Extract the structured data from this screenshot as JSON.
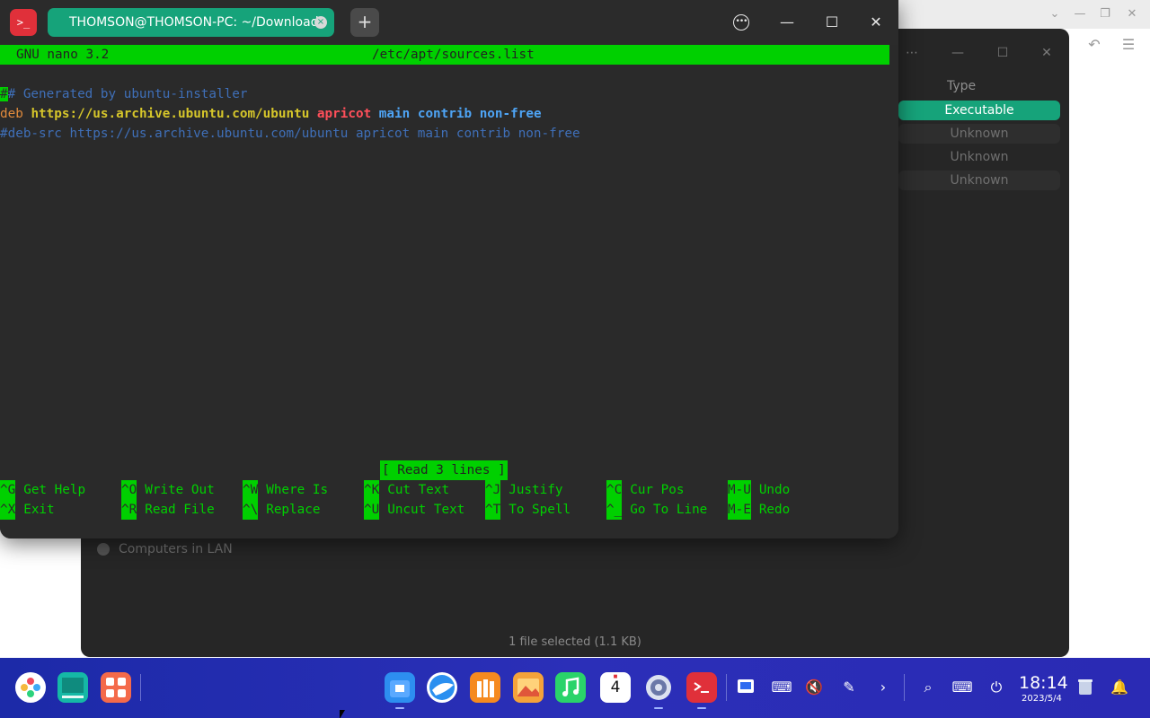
{
  "terminal": {
    "tab_title": "THOMSON@THOMSON-PC: ~/Downloads",
    "tab_close": "×",
    "new_tab": "+",
    "app_icon": ">_",
    "menu_icon": "•••",
    "minimize": "—",
    "maximize": "☐",
    "close": "✕"
  },
  "nano": {
    "version": "GNU nano 3.2",
    "filename": "/etc/apt/sources.list",
    "lines": [
      {
        "cursor": "#",
        "rest": "# Generated by ubuntu-installer"
      },
      {
        "keyword": "deb",
        "url": "https://us.archive.ubuntu.com/ubuntu",
        "dist": "apricot",
        "components": "main contrib non-free"
      },
      {
        "comment": "#deb-src https://us.archive.ubuntu.com/ubuntu apricot main contrib non-free"
      }
    ],
    "status": "[ Read 3 lines ]",
    "shortcuts": [
      {
        "key": "^G",
        "label": "Get Help"
      },
      {
        "key": "^O",
        "label": "Write Out"
      },
      {
        "key": "^W",
        "label": "Where Is"
      },
      {
        "key": "^K",
        "label": "Cut Text"
      },
      {
        "key": "^J",
        "label": "Justify"
      },
      {
        "key": "^C",
        "label": "Cur Pos"
      },
      {
        "key": "M-U",
        "label": "Undo"
      },
      {
        "key": "^X",
        "label": "Exit"
      },
      {
        "key": "^R",
        "label": "Read File"
      },
      {
        "key": "^\\",
        "label": "Replace"
      },
      {
        "key": "^U",
        "label": "Uncut Text"
      },
      {
        "key": "^T",
        "label": "To Spell"
      },
      {
        "key": "^_",
        "label": "Go To Line"
      },
      {
        "key": "M-E",
        "label": "Redo"
      }
    ]
  },
  "file_manager": {
    "type_header": "Type",
    "types": [
      "Executable",
      "Unknown",
      "Unknown",
      "Unknown"
    ],
    "sidebar_lan": "Computers in LAN",
    "status": "1 file selected (1.1 KB)"
  },
  "taskbar": {
    "time": "18:14",
    "date": "2023/5/4",
    "calendar_day": "4",
    "colors": {
      "background": "#2b2fb8",
      "accent": "#16a37a",
      "nano_green": "#00d000"
    }
  }
}
